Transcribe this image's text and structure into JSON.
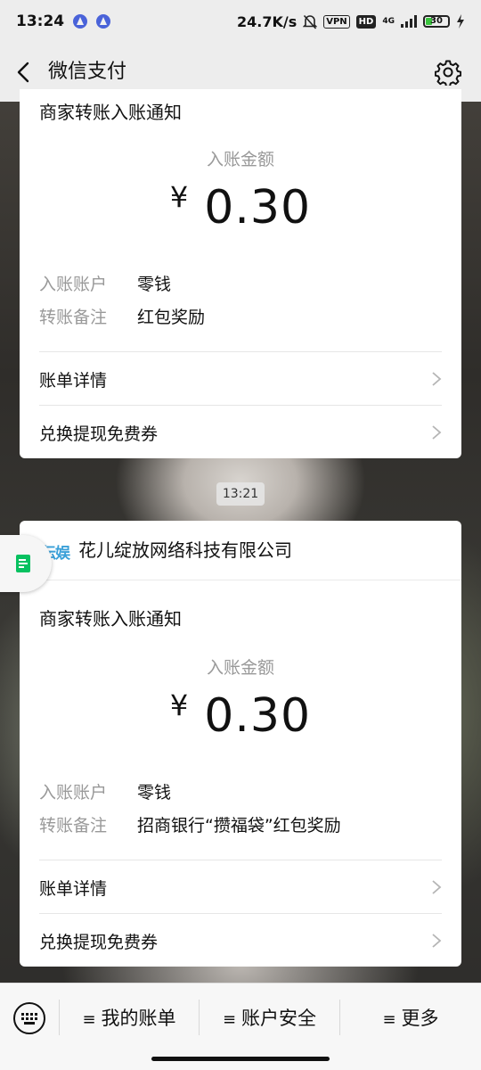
{
  "status_bar": {
    "time": "13:24",
    "speed": "24.7K/s",
    "vpn": "VPN",
    "hd": "HD",
    "network": "4G",
    "battery": "30",
    "battery_level": 0.3
  },
  "nav": {
    "title": "微信支付"
  },
  "card1": {
    "title": "商家转账入账通知",
    "amount_label": "入账金额",
    "currency": "¥",
    "amount": "0.30",
    "account_key": "入账账户",
    "account_val": "零钱",
    "note_key": "转账备注",
    "note_val": "红包奖励",
    "link1": "账单详情",
    "link2": "兑换提现免费券"
  },
  "timestamp": "13:21",
  "card2": {
    "merchant_logo_text": "伝娱",
    "merchant": "花儿绽放网络科技有限公司",
    "title": "商家转账入账通知",
    "amount_label": "入账金额",
    "currency": "¥",
    "amount": "0.30",
    "account_key": "入账账户",
    "account_val": "零钱",
    "note_key": "转账备注",
    "note_val": "招商银行“攒福袋”红包奖励",
    "link1": "账单详情",
    "link2": "兑换提现免费券"
  },
  "bottom": {
    "menu_icon": "≡",
    "item1": "我的账单",
    "item2": "账户安全",
    "item3": "更多"
  },
  "icons": {
    "back": "chevron-left-icon",
    "settings": "gear-icon",
    "keyboard": "keyboard-icon",
    "float": "document-icon"
  },
  "colors": {
    "accent_green": "#07c160",
    "merchant_blue": "#3aa0d8"
  }
}
